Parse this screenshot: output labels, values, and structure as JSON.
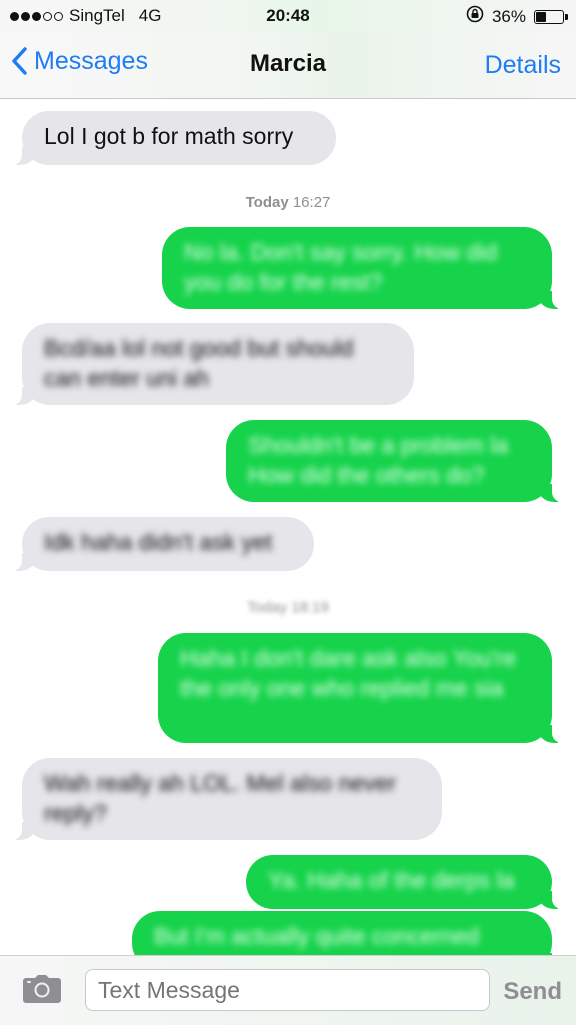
{
  "status_bar": {
    "carrier": "SingTel",
    "network": "4G",
    "time": "20:48",
    "battery_percent": "36%",
    "battery_level": 0.36,
    "signal_bars_filled": 3,
    "signal_bars_total": 5,
    "icons": [
      "signal-dots-icon",
      "orientation-lock-icon",
      "battery-icon"
    ]
  },
  "nav": {
    "back_label": "Messages",
    "title": "Marcia",
    "details_label": "Details",
    "accent_color": "#1e7cf5"
  },
  "colors": {
    "incoming_bubble": "#e5e5ea",
    "outgoing_bubble": "#16d34b"
  },
  "thread": {
    "first_message": {
      "text": "Lol I got b for math sorry",
      "direction": "incoming"
    },
    "timestamp_1": {
      "day": "Today",
      "time": "16:27"
    },
    "messages_1": [
      {
        "text": "No la. Don't say sorry. How did you do for the rest?",
        "direction": "outgoing"
      },
      {
        "text": "Bcd/aa lol not good but should can enter uni ah",
        "direction": "incoming"
      },
      {
        "text": "Shouldn't be a problem la How did the others do?",
        "direction": "outgoing"
      },
      {
        "text": "Idk haha didn't ask yet",
        "direction": "incoming"
      }
    ],
    "timestamp_2": {
      "day": "Today",
      "time": "18:19"
    },
    "messages_2": [
      {
        "text": "Haha I don't dare ask also You're the only one who replied me sia",
        "direction": "outgoing"
      },
      {
        "text": "Wah really ah LOL. Mel also never reply?",
        "direction": "incoming"
      },
      {
        "text": "Ya. Haha of the derps la",
        "direction": "outgoing"
      },
      {
        "text": "But I'm actually quite concerned",
        "direction": "outgoing"
      }
    ]
  },
  "input_bar": {
    "placeholder": "Text Message",
    "send_label": "Send"
  }
}
